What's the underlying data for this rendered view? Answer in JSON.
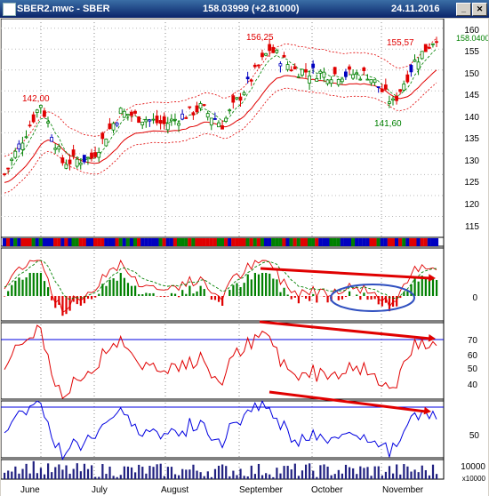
{
  "window": {
    "title": "SBER2.mwc - SBER",
    "quote": "158.03999 (+2.81000)",
    "date": "24.11.2016"
  },
  "price_panel": {
    "axis_ticks": [
      "160",
      "155",
      "150",
      "145",
      "140",
      "135",
      "130",
      "125",
      "120",
      "115"
    ],
    "last_price_tag": "158.0400",
    "annotations": [
      "142,00",
      "156,25",
      "155,57",
      "141,60"
    ]
  },
  "oscillator_panel": {
    "axis_ticks": [
      "0"
    ]
  },
  "rsi_panel": {
    "axis_ticks": [
      "70",
      "60",
      "50",
      "40"
    ]
  },
  "stoch_panel": {
    "axis_ticks": [
      "50"
    ]
  },
  "volume_panel": {
    "axis_ticks": [
      "10000",
      "x10000"
    ]
  },
  "time_axis": {
    "labels": [
      "June",
      "July",
      "August",
      "September",
      "October",
      "November"
    ]
  },
  "colors": {
    "up": "#008000",
    "down": "#e00000",
    "neutral": "#0000c0",
    "band": "#e00000",
    "arrow": "#e00000",
    "line_blue": "#0000e0",
    "accent": "#3050c0"
  }
}
